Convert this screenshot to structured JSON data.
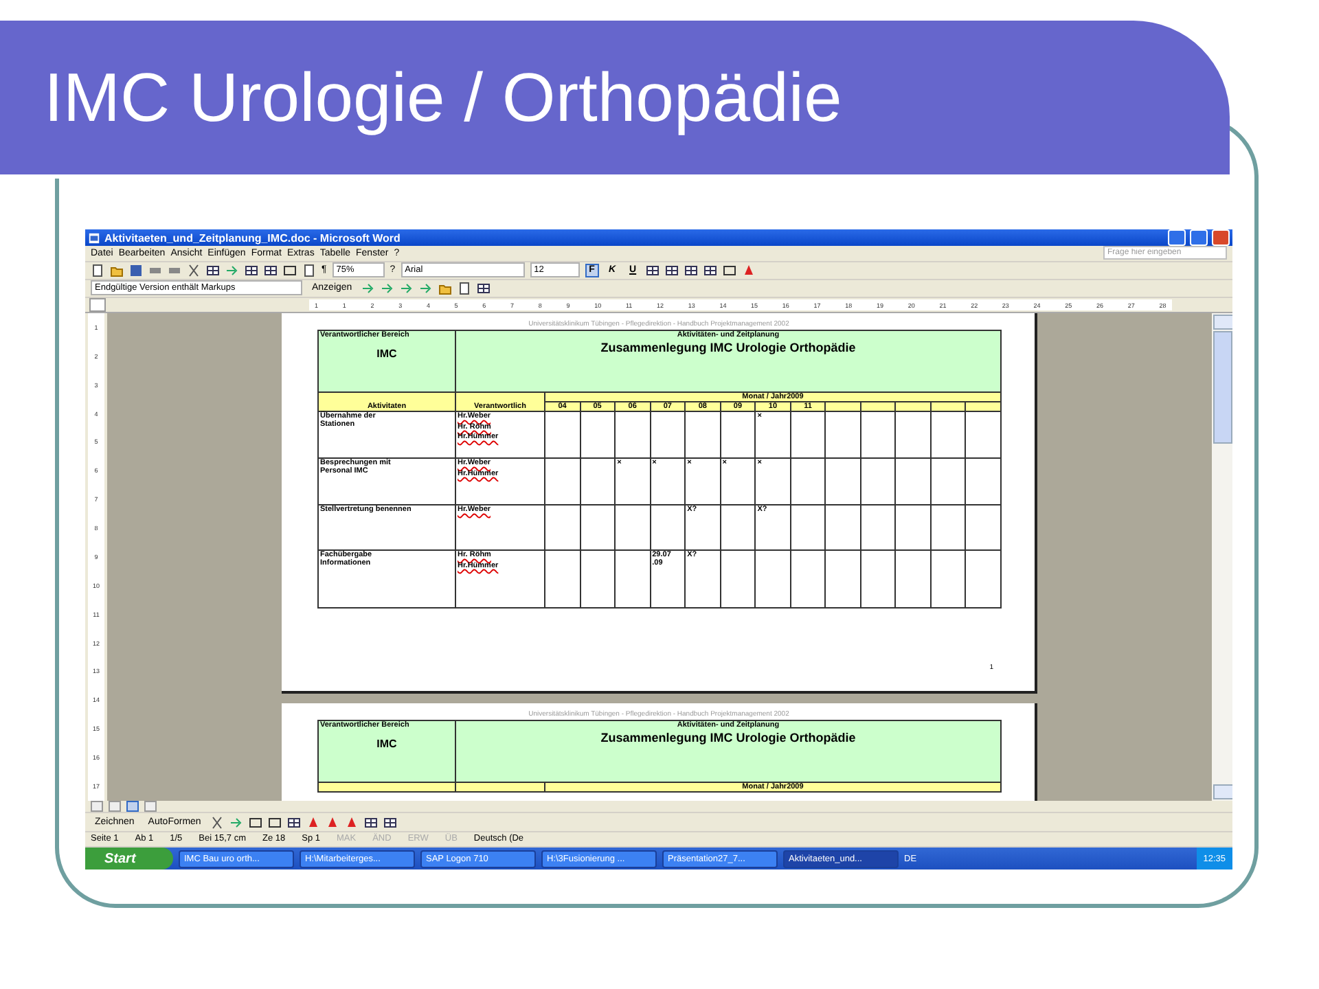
{
  "slide_title": "IMC Urologie / Orthopädie",
  "window": {
    "title": "Aktivitaeten_und_Zeitplanung_IMC.doc - Microsoft Word"
  },
  "menu": [
    "Datei",
    "Bearbeiten",
    "Ansicht",
    "Einfügen",
    "Format",
    "Extras",
    "Tabelle",
    "Fenster",
    "?"
  ],
  "help_field": {
    "placeholder": "Frage hier eingeben"
  },
  "toolbar": {
    "zoom": "75%",
    "pilcrow": "¶",
    "help": "?",
    "font": "Arial",
    "size": "12",
    "format_buttons": [
      {
        "label": "F",
        "selected": true
      },
      {
        "label": "K",
        "selected": false
      },
      {
        "label": "U",
        "selected": false
      }
    ]
  },
  "review_toolbar": {
    "markup": "Endgültige Version enthält Markups",
    "show": "Anzeigen"
  },
  "ruler": {
    "horizontal": [
      "1",
      "1",
      "2",
      "3",
      "4",
      "5",
      "6",
      "7",
      "8",
      "9",
      "10",
      "11",
      "12",
      "13",
      "14",
      "15",
      "16",
      "17",
      "18",
      "19",
      "20",
      "21",
      "22",
      "23",
      "24",
      "25",
      "26",
      "27",
      "28"
    ],
    "vertical": [
      "1",
      "2",
      "3",
      "4",
      "5",
      "6",
      "7",
      "8",
      "9",
      "10",
      "11",
      "12",
      "13",
      "14",
      "15",
      "16",
      "17"
    ]
  },
  "pages": [
    {
      "header": "Universitätsklinikum Tübingen - Pflegedirektion - Handbuch Projektmanagement 2002",
      "table": {
        "area_label": "Verantwortlicher Bereich",
        "area": "IMC",
        "plan_label": "Aktivitäten- und Zeitplanung",
        "plan_title": "Zusammenlegung IMC Urologie Orthopädie",
        "month_header": "Monat / Jahr2009",
        "columns": [
          "Aktivitaten",
          "Verantwortlich"
        ],
        "months": [
          "04",
          "05",
          "06",
          "07",
          "08",
          "09",
          "10",
          "11"
        ],
        "rows": [
          {
            "activity": "Übernahme der\nStationen",
            "responsible": [
              "Hr.Weber",
              "Hr. Röhm",
              "Hr.Hümmer"
            ],
            "cells": [
              null,
              null,
              null,
              null,
              null,
              null,
              "×",
              null
            ]
          },
          {
            "activity": "Besprechungen mit\nPersonal IMC",
            "responsible": [
              "Hr.Weber",
              "Hr.Hümmer"
            ],
            "cells": [
              null,
              null,
              "×",
              "×",
              "×",
              "×",
              "×",
              null
            ]
          },
          {
            "activity": "Stellvertretung benennen",
            "responsible": [
              "Hr.Weber"
            ],
            "cells": [
              null,
              null,
              null,
              null,
              "X?",
              null,
              "X?",
              null
            ]
          },
          {
            "activity": "Fachübergabe\nInformationen",
            "responsible": [
              "Hr. Röhm",
              "Hr.Hümmer"
            ],
            "cells": [
              null,
              null,
              null,
              "29.07 .09",
              "X?",
              null,
              null,
              null
            ]
          }
        ]
      },
      "page_number": "1"
    },
    {
      "header": "Universitätsklinikum Tübingen - Pflegedirektion - Handbuch Projektmanagement 2002",
      "table": {
        "area_label": "Verantwortlicher Bereich",
        "area": "IMC",
        "plan_label": "Aktivitäten- und Zeitplanung",
        "plan_title": "Zusammenlegung IMC Urologie Orthopädie",
        "month_header": "Monat / Jahr2009"
      }
    }
  ],
  "view_buttons": [
    {
      "selected": false
    },
    {
      "selected": false
    },
    {
      "selected": true
    },
    {
      "selected": false
    }
  ],
  "drawing_toolbar": {
    "draw": "Zeichnen",
    "autoshapes": "AutoFormen"
  },
  "status_bar": [
    {
      "text": "Seite 1",
      "disabled": false
    },
    {
      "text": "Ab 1",
      "disabled": false
    },
    {
      "text": "1/5",
      "disabled": false
    },
    {
      "text": "Bei 15,7 cm",
      "disabled": false
    },
    {
      "text": "Ze 18",
      "disabled": false
    },
    {
      "text": "Sp 1",
      "disabled": false
    },
    {
      "text": "MAK",
      "disabled": true
    },
    {
      "text": "ÄND",
      "disabled": true
    },
    {
      "text": "ERW",
      "disabled": true
    },
    {
      "text": "ÜB",
      "disabled": true
    },
    {
      "text": "Deutsch (De",
      "disabled": false
    }
  ],
  "taskbar": {
    "start": "Start",
    "items": [
      {
        "label": "IMC Bau uro orth...",
        "selected": false
      },
      {
        "label": "H:\\Mitarbeiterges...",
        "selected": false
      },
      {
        "label": "SAP Logon 710",
        "selected": false
      },
      {
        "label": "H:\\3Fusionierung ...",
        "selected": false
      },
      {
        "label": "Präsentation27_7...",
        "selected": false
      },
      {
        "label": "Aktivitaeten_und...",
        "selected": true
      }
    ],
    "language": "DE",
    "clock": "12:35"
  }
}
